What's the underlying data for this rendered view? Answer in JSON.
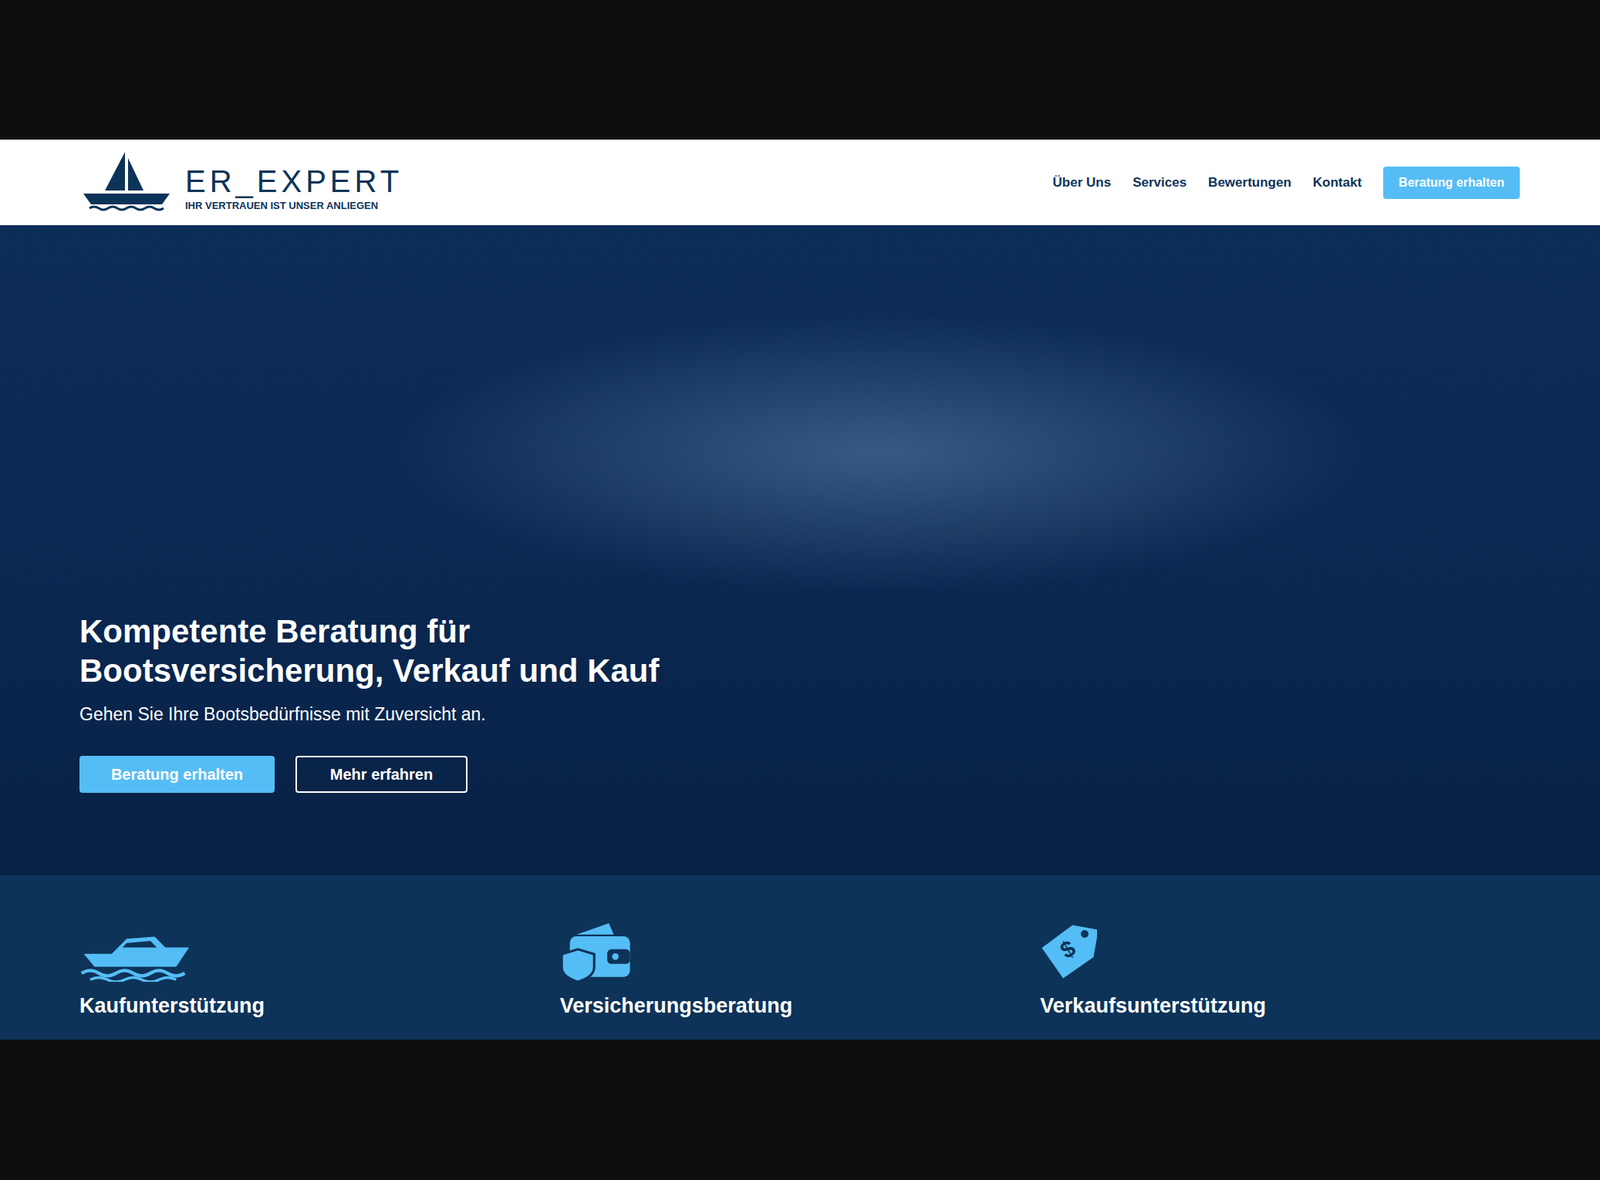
{
  "header": {
    "logo": {
      "name": "ER_EXPERT",
      "tagline": "IHR VERTRAUEN IST UNSER ANLIEGEN"
    },
    "nav": [
      "Über Uns",
      "Services",
      "Bewertungen",
      "Kontakt"
    ],
    "cta": "Beratung erhalten"
  },
  "hero": {
    "title_lines": [
      "Kompetente Beratung für",
      "Bootsversicherung, Verkauf und Kauf"
    ],
    "subtitle": "Gehen Sie Ihre Bootsbedürfnisse mit Zuversicht an.",
    "primary_button": "Beratung erhalten",
    "secondary_button": "Mehr erfahren"
  },
  "services": [
    "Kaufunterstützung",
    "Versicherungsberatung",
    "Verkaufsunterstützung"
  ]
}
